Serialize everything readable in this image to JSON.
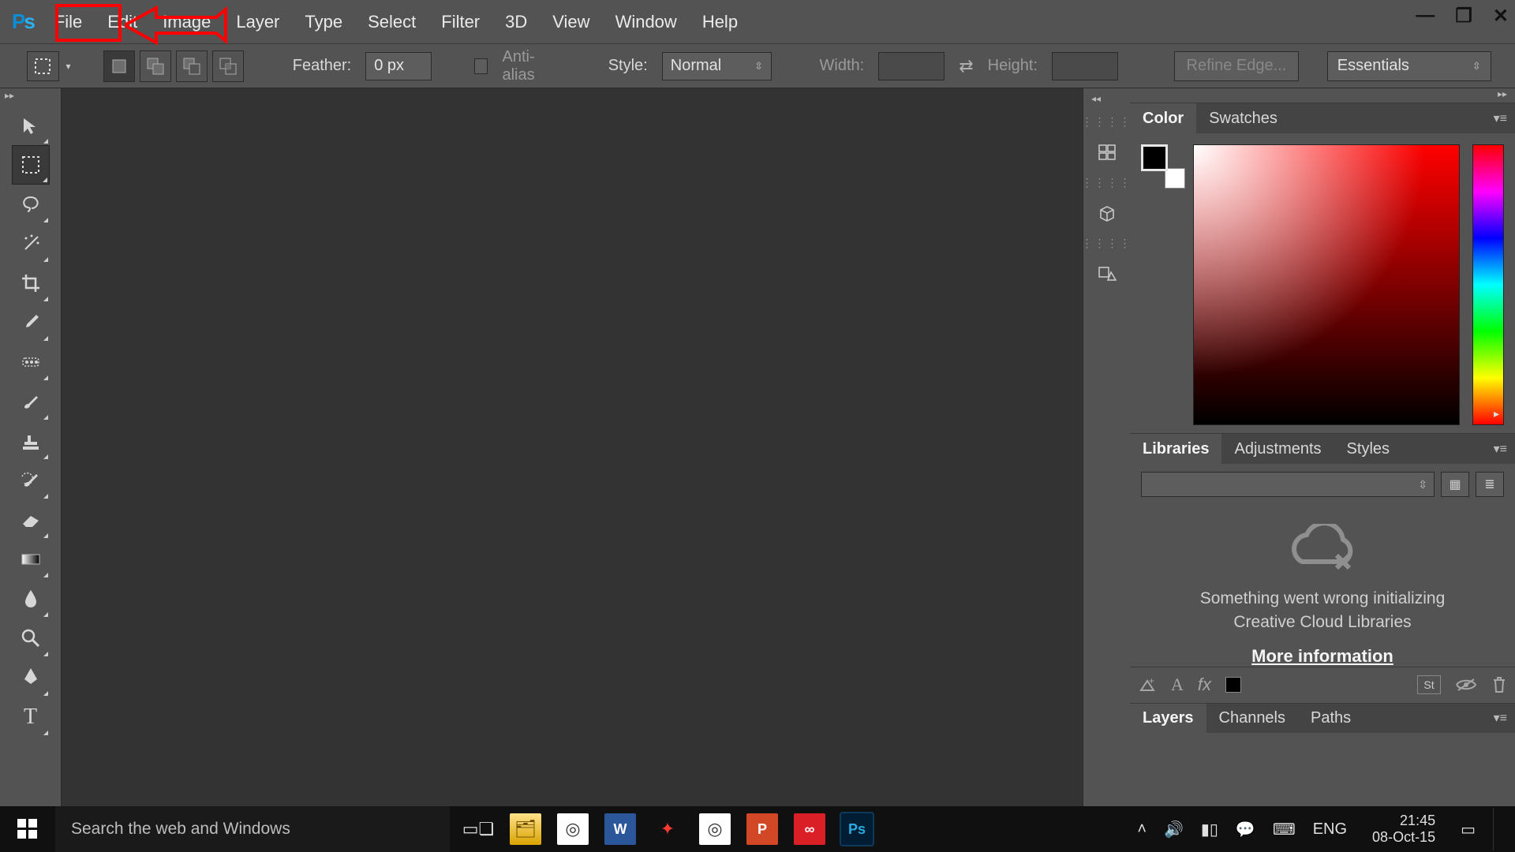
{
  "menu": {
    "items": [
      "File",
      "Edit",
      "Image",
      "Layer",
      "Type",
      "Select",
      "Filter",
      "3D",
      "View",
      "Window",
      "Help"
    ]
  },
  "options": {
    "feather_label": "Feather:",
    "feather_value": "0 px",
    "antialias_label": "Anti-alias",
    "style_label": "Style:",
    "style_value": "Normal",
    "width_label": "Width:",
    "height_label": "Height:",
    "refine_label": "Refine Edge...",
    "workspace": "Essentials"
  },
  "panels": {
    "color_tab": "Color",
    "swatches_tab": "Swatches",
    "libraries_tab": "Libraries",
    "adjustments_tab": "Adjustments",
    "styles_tab": "Styles",
    "layers_tab": "Layers",
    "channels_tab": "Channels",
    "paths_tab": "Paths",
    "lib_error_l1": "Something went wrong initializing",
    "lib_error_l2": "Creative Cloud Libraries",
    "lib_more": "More information",
    "layer_bottom_st": "St"
  },
  "taskbar": {
    "search_placeholder": "Search the web and Windows",
    "lang": "ENG",
    "time": "21:45",
    "date": "08-Oct-15"
  },
  "colors": {
    "accent_red": "#ff0000",
    "fg": "#000000",
    "bg": "#ffffff"
  }
}
